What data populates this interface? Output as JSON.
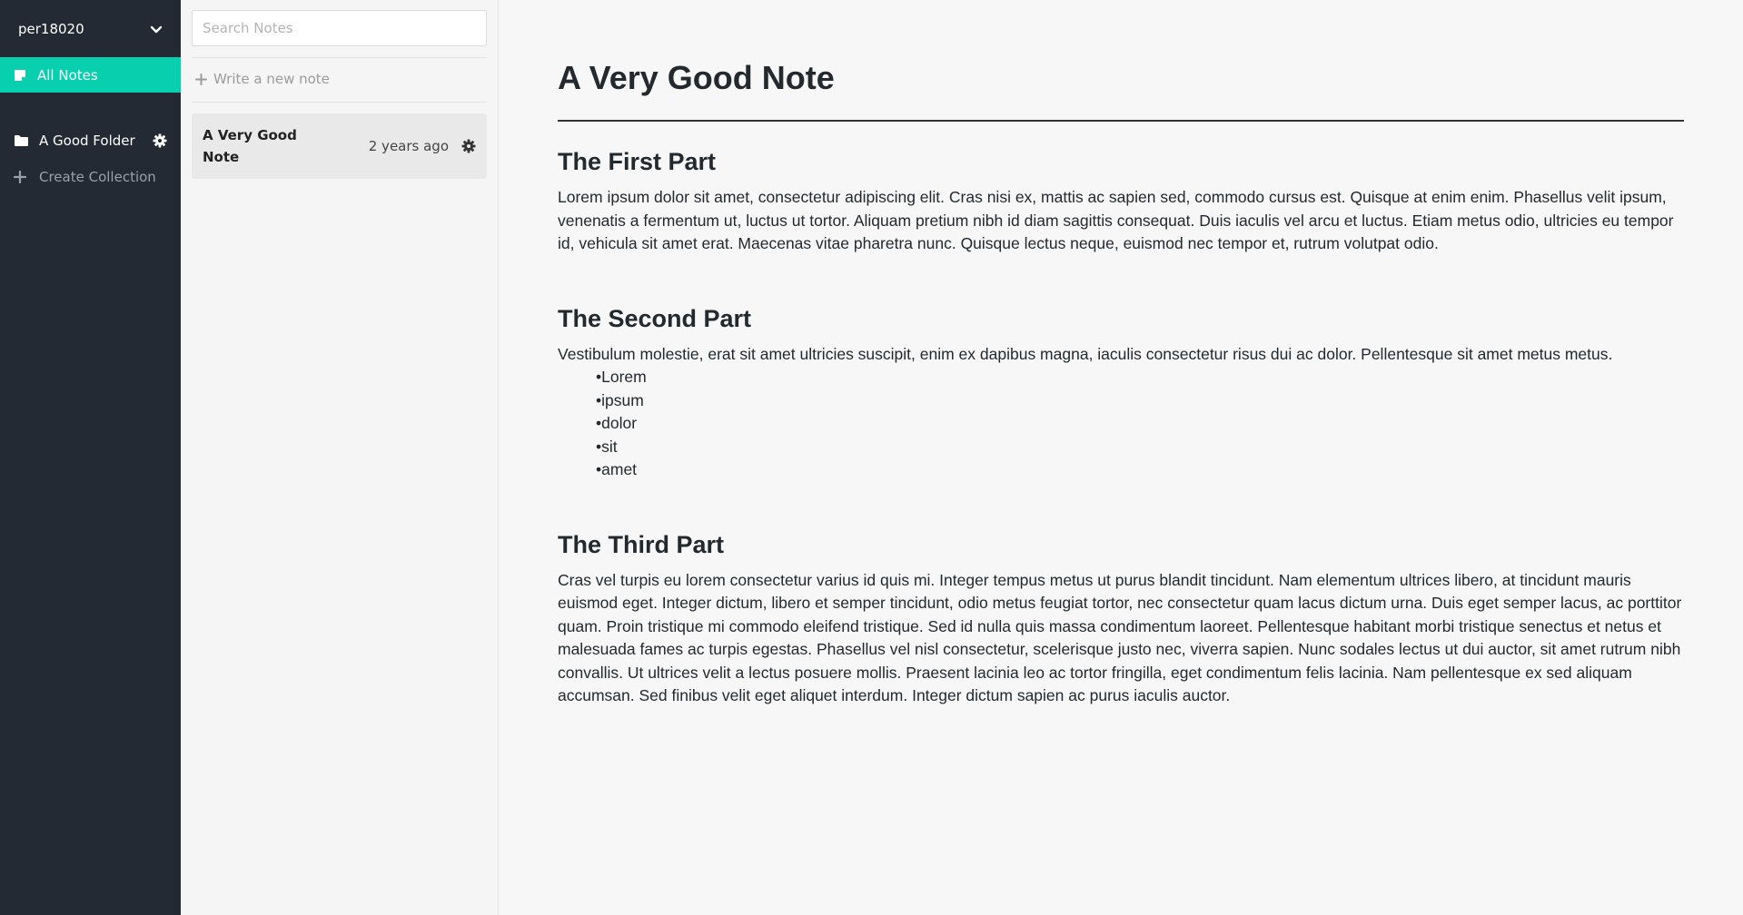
{
  "sidebar": {
    "user_name": "per18020",
    "user_menu_icon": "chevron-down-icon",
    "all_notes": {
      "label": "All Notes",
      "icon": "note-icon"
    },
    "folders": [
      {
        "label": "A Good Folder",
        "icon": "folder-icon",
        "settings_icon": "gear-icon"
      }
    ],
    "create_collection": {
      "label": "Create Collection",
      "icon": "plus-icon"
    },
    "accent_color": "#08d0ae",
    "background_color": "#232a34"
  },
  "notes_list": {
    "search_placeholder": "Search Notes",
    "write_new_note": "Write a new note",
    "notes": [
      {
        "title": "A Very Good Note",
        "time": "2 years ago",
        "settings_icon": "gear-icon"
      }
    ]
  },
  "editor": {
    "title": "A Very Good Note",
    "sections": [
      {
        "heading": "The First Part",
        "paragraph": "Lorem ipsum dolor sit amet, consectetur adipiscing elit. Cras nisi ex, mattis ac sapien sed, commodo cursus est. Quisque at enim enim. Phasellus velit ipsum, venenatis a fermentum ut, luctus ut tortor. Aliquam pretium nibh id diam sagittis consequat. Duis iaculis vel arcu et luctus. Etiam metus odio, ultricies eu tempor id, vehicula sit amet erat. Maecenas vitae pharetra nunc. Quisque lectus neque, euismod nec tempor et, rutrum volutpat odio."
      },
      {
        "heading": "The Second Part",
        "paragraph": "Vestibulum molestie, erat sit amet ultricies suscipit, enim ex dapibus magna, iaculis consectetur risus dui ac dolor. Pellentesque sit amet metus metus.",
        "list": [
          "Lorem",
          "ipsum",
          "dolor",
          "sit",
          "amet"
        ]
      },
      {
        "heading": "The Third Part",
        "paragraph": "Cras vel turpis eu lorem consectetur varius id quis mi. Integer tempus metus ut purus blandit tincidunt. Nam elementum ultrices libero, at tincidunt mauris euismod eget. Integer dictum, libero et semper tincidunt, odio metus feugiat tortor, nec consectetur quam lacus dictum urna. Duis eget semper lacus, ac porttitor quam. Proin tristique mi commodo eleifend tristique. Sed id nulla quis massa condimentum laoreet. Pellentesque habitant morbi tristique senectus et netus et malesuada fames ac turpis egestas. Phasellus vel nisl consectetur, scelerisque justo nec, viverra sapien. Nunc sodales lectus ut dui auctor, sit amet rutrum nibh convallis. Ut ultrices velit a lectus posuere mollis. Praesent lacinia leo ac tortor fringilla, eget condimentum felis lacinia. Nam pellentesque ex sed aliquam accumsan. Sed finibus velit eget aliquet interdum. Integer dictum sapien ac purus iaculis auctor."
      }
    ]
  }
}
